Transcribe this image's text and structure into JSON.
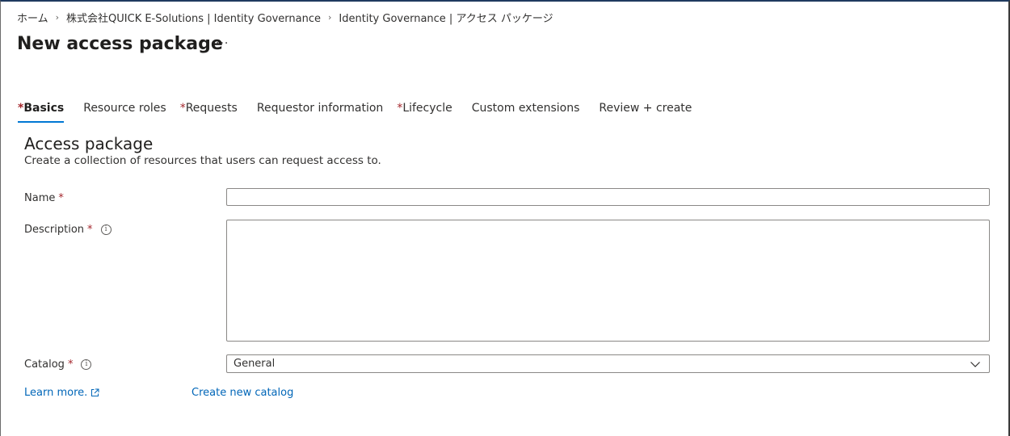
{
  "breadcrumb": {
    "items": [
      "ホーム",
      "株式会社QUICK E-Solutions | Identity Governance",
      "Identity Governance | アクセス パッケージ"
    ],
    "separator": "›"
  },
  "header": {
    "title": "New access package",
    "more_label": "···"
  },
  "tabs": [
    {
      "required_mark": "*",
      "label": "Basics"
    },
    {
      "required_mark": "",
      "label": "Resource roles"
    },
    {
      "required_mark": "*",
      "label": "Requests"
    },
    {
      "required_mark": "",
      "label": "Requestor information"
    },
    {
      "required_mark": "*",
      "label": "Lifecycle"
    },
    {
      "required_mark": "",
      "label": "Custom extensions"
    },
    {
      "required_mark": "",
      "label": "Review + create"
    }
  ],
  "active_tab": "Basics",
  "section": {
    "title": "Access package",
    "description": "Create a collection of resources that users can request access to."
  },
  "form": {
    "required_mark": "*",
    "info_glyph": "i",
    "name": {
      "label": "Name",
      "value": ""
    },
    "description": {
      "label": "Description",
      "value": ""
    },
    "catalog": {
      "label": "Catalog",
      "value": "General"
    }
  },
  "links": {
    "learn_more": "Learn more.",
    "create_catalog": "Create new catalog"
  },
  "colors": {
    "accent": "#0078d4",
    "link": "#0066b8",
    "required": "#a4262c"
  },
  "icons": [
    "chevron-right-icon",
    "more-icon",
    "info-icon",
    "chevron-down-icon",
    "external-link-icon"
  ]
}
